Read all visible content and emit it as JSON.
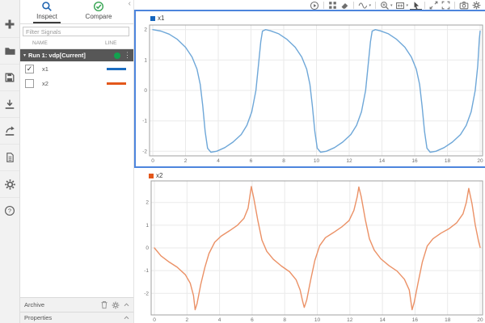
{
  "left_rail": {
    "icons": [
      "new",
      "open",
      "save",
      "import",
      "export",
      "create-report",
      "preferences",
      "help"
    ]
  },
  "signal_panel": {
    "tabs": [
      {
        "label": "Inspect",
        "active": true
      },
      {
        "label": "Compare",
        "active": false
      }
    ],
    "filter_placeholder": "Filter Signals",
    "columns": {
      "name": "NAME",
      "line": "LINE"
    },
    "run_row": {
      "label": "Run 1: vdp[Current]",
      "status_color": "#12a24f"
    },
    "signals": [
      {
        "name": "x1",
        "checked": true,
        "color": "#1b6cc0"
      },
      {
        "name": "x2",
        "checked": false,
        "color": "#e3571b"
      }
    ],
    "archive": {
      "label": "Archive"
    },
    "properties": {
      "label": "Properties"
    }
  },
  "toolbar": {
    "icons": [
      "run-explorer",
      "layout",
      "clear-results",
      "signal-generator",
      "zoom",
      "fit-to-view",
      "pointer",
      "expand",
      "fullscreen",
      "snapshot",
      "settings"
    ],
    "active_icon": "pointer"
  },
  "selection": {
    "selected_plot": "x1",
    "border_color": "#4d85dd"
  },
  "chart_data": [
    {
      "type": "line",
      "series": "x1",
      "color": "#6ea7d8",
      "legend_color": "#1565bd",
      "xlim": [
        0,
        20
      ],
      "ylim": [
        -2.15,
        2.15
      ],
      "xticks": [
        0,
        2,
        4,
        6,
        8,
        10,
        12,
        14,
        16,
        18,
        20
      ],
      "yticks": [
        -2,
        -1,
        0,
        1,
        2
      ],
      "grid": true,
      "legend_position": "top-left",
      "x": [
        0,
        0.5,
        1.0,
        1.5,
        2.0,
        2.4,
        2.7,
        2.9,
        3.05,
        3.2,
        3.35,
        3.55,
        3.9,
        4.4,
        4.9,
        5.4,
        5.75,
        6.05,
        6.3,
        6.45,
        6.6,
        6.7,
        6.9,
        7.2,
        7.7,
        8.2,
        8.7,
        9.1,
        9.4,
        9.6,
        9.75,
        9.9,
        10.05,
        10.25,
        10.6,
        11.1,
        11.6,
        12.1,
        12.45,
        12.75,
        13.0,
        13.15,
        13.3,
        13.4,
        13.6,
        13.9,
        14.4,
        14.9,
        15.4,
        15.8,
        16.1,
        16.3,
        16.45,
        16.6,
        16.75,
        16.95,
        17.3,
        17.8,
        18.3,
        18.8,
        19.15,
        19.45,
        19.7,
        19.85,
        19.95,
        20
      ],
      "y": [
        2.0,
        1.95,
        1.85,
        1.68,
        1.42,
        1.1,
        0.7,
        0.2,
        -0.5,
        -1.35,
        -1.9,
        -2.03,
        -2.0,
        -1.88,
        -1.7,
        -1.45,
        -1.15,
        -0.7,
        0.0,
        0.8,
        1.6,
        1.95,
        2.0,
        1.96,
        1.86,
        1.68,
        1.42,
        1.1,
        0.7,
        0.2,
        -0.5,
        -1.35,
        -1.9,
        -2.03,
        -2.0,
        -1.88,
        -1.7,
        -1.45,
        -1.15,
        -0.7,
        0.0,
        0.8,
        1.6,
        1.95,
        2.0,
        1.96,
        1.86,
        1.68,
        1.42,
        1.1,
        0.7,
        0.2,
        -0.5,
        -1.35,
        -1.9,
        -2.03,
        -2.0,
        -1.88,
        -1.7,
        -1.45,
        -1.15,
        -0.7,
        0.0,
        0.8,
        1.7,
        1.95
      ]
    },
    {
      "type": "line",
      "series": "x2",
      "color": "#eb9166",
      "legend_color": "#e3571b",
      "xlim": [
        0,
        20
      ],
      "ylim": [
        -2.95,
        2.95
      ],
      "xticks": [
        0,
        2,
        4,
        6,
        8,
        10,
        12,
        14,
        16,
        18,
        20
      ],
      "yticks": [
        -2,
        -1,
        0,
        1,
        2
      ],
      "grid": true,
      "legend_position": "top-left",
      "x": [
        0,
        0.4,
        0.9,
        1.4,
        1.9,
        2.2,
        2.4,
        2.5,
        2.62,
        2.85,
        3.1,
        3.35,
        3.7,
        4.1,
        4.6,
        5.1,
        5.5,
        5.75,
        5.95,
        6.1,
        6.35,
        6.6,
        6.9,
        7.3,
        7.8,
        8.3,
        8.7,
        8.95,
        9.1,
        9.2,
        9.35,
        9.6,
        9.85,
        10.15,
        10.5,
        11.0,
        11.5,
        11.95,
        12.25,
        12.45,
        12.55,
        12.7,
        12.95,
        13.2,
        13.5,
        13.9,
        14.4,
        14.9,
        15.35,
        15.65,
        15.82,
        15.95,
        16.2,
        16.45,
        16.75,
        17.1,
        17.6,
        18.1,
        18.55,
        18.95,
        19.15,
        19.3,
        19.5,
        19.7,
        19.9,
        20
      ],
      "y": [
        0,
        -0.35,
        -0.62,
        -0.85,
        -1.18,
        -1.55,
        -2.1,
        -2.72,
        -2.45,
        -1.6,
        -0.85,
        -0.25,
        0.25,
        0.52,
        0.75,
        1.0,
        1.3,
        1.75,
        2.7,
        2.2,
        1.2,
        0.35,
        -0.15,
        -0.5,
        -0.8,
        -1.05,
        -1.4,
        -1.85,
        -2.35,
        -2.62,
        -2.3,
        -1.4,
        -0.55,
        0.1,
        0.45,
        0.68,
        0.92,
        1.2,
        1.65,
        2.25,
        2.68,
        2.25,
        1.25,
        0.4,
        -0.1,
        -0.48,
        -0.78,
        -1.02,
        -1.38,
        -1.85,
        -2.72,
        -2.4,
        -1.5,
        -0.62,
        0.08,
        0.4,
        0.65,
        0.85,
        1.1,
        1.5,
        2.0,
        2.62,
        1.95,
        1.0,
        0.3,
        0.02
      ]
    }
  ]
}
